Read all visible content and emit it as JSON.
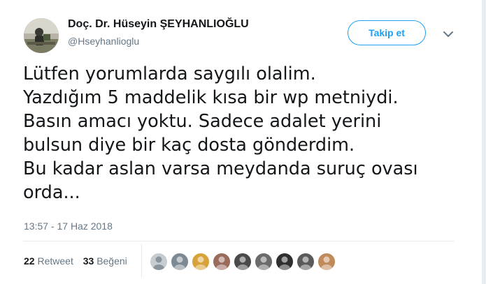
{
  "author": {
    "name": "Doç. Dr. Hüseyin ŞEYHANLIOĞLU",
    "handle": "@Hseyhanlioglu",
    "avatar_icon": "user-profile-photo"
  },
  "follow_button": {
    "label": "Takip et"
  },
  "menu": {
    "icon": "chevron-down-icon"
  },
  "tweet": {
    "lines": [
      "Lütfen yorumlarda saygılı olalim.",
      "Yazdığım 5 maddelik kısa bir wp metniydi.",
      "Basın amacı yoktu. Sadece adalet yerini",
      "bulsun diye bir kaç dosta gönderdim.",
      "Bu kadar aslan varsa meydanda suruç ovası",
      "orda..."
    ],
    "timestamp": "13:57 - 17 Haz 2018"
  },
  "stats": {
    "retweets_count": "22",
    "retweets_label": "Retweet",
    "likes_count": "33",
    "likes_label": "Beğeni"
  },
  "likers": [
    {
      "icon": "default-avatar-icon",
      "color": "#c5ccd2"
    },
    {
      "icon": "user-avatar-icon",
      "color": "#7d8a94"
    },
    {
      "icon": "emblem-avatar-icon",
      "color": "#d8a23a"
    },
    {
      "icon": "user-avatar-icon",
      "color": "#9a6b5c"
    },
    {
      "icon": "user-avatar-icon",
      "color": "#4a4a4a"
    },
    {
      "icon": "user-avatar-icon",
      "color": "#6b6b6b"
    },
    {
      "icon": "user-avatar-icon",
      "color": "#2f2f2f"
    },
    {
      "icon": "user-avatar-icon",
      "color": "#5a5a5a"
    },
    {
      "icon": "user-avatar-icon",
      "color": "#c08a5a"
    }
  ],
  "colors": {
    "accent": "#1da1f2",
    "text_primary": "#14171a",
    "text_secondary": "#657786",
    "divider": "#e6ecf0"
  }
}
